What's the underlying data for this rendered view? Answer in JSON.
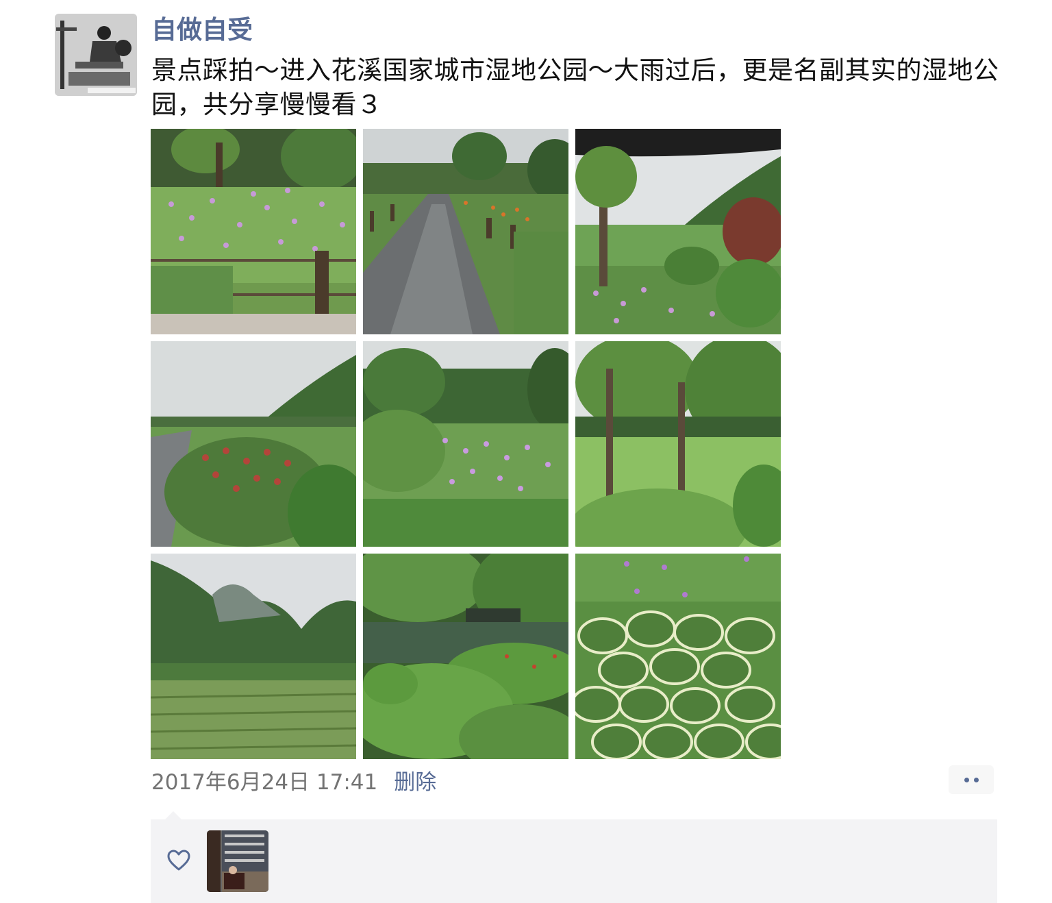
{
  "post": {
    "username": "自做自受",
    "text": "景点踩拍～进入花溪国家城市湿地公园～大雨过后，更是名副其实的湿地公园，共分享慢慢看３",
    "timestamp": "2017年6月24日 17:41",
    "delete_label": "删除",
    "photos": [
      {
        "subject": "iris-flowers-fence"
      },
      {
        "subject": "wet-path"
      },
      {
        "subject": "umbrella-field"
      },
      {
        "subject": "hill-shrubs"
      },
      {
        "subject": "iris-meadow"
      },
      {
        "subject": "lawn-trees"
      },
      {
        "subject": "misty-mountain-field"
      },
      {
        "subject": "pond-shrubs"
      },
      {
        "subject": "hosta-leaves"
      }
    ]
  },
  "colors": {
    "link": "#576b95",
    "text": "#111111",
    "meta": "#737373",
    "like_bg": "#f3f3f5"
  },
  "icons": {
    "like": "heart-outline-icon",
    "more": "two-dots-icon"
  }
}
